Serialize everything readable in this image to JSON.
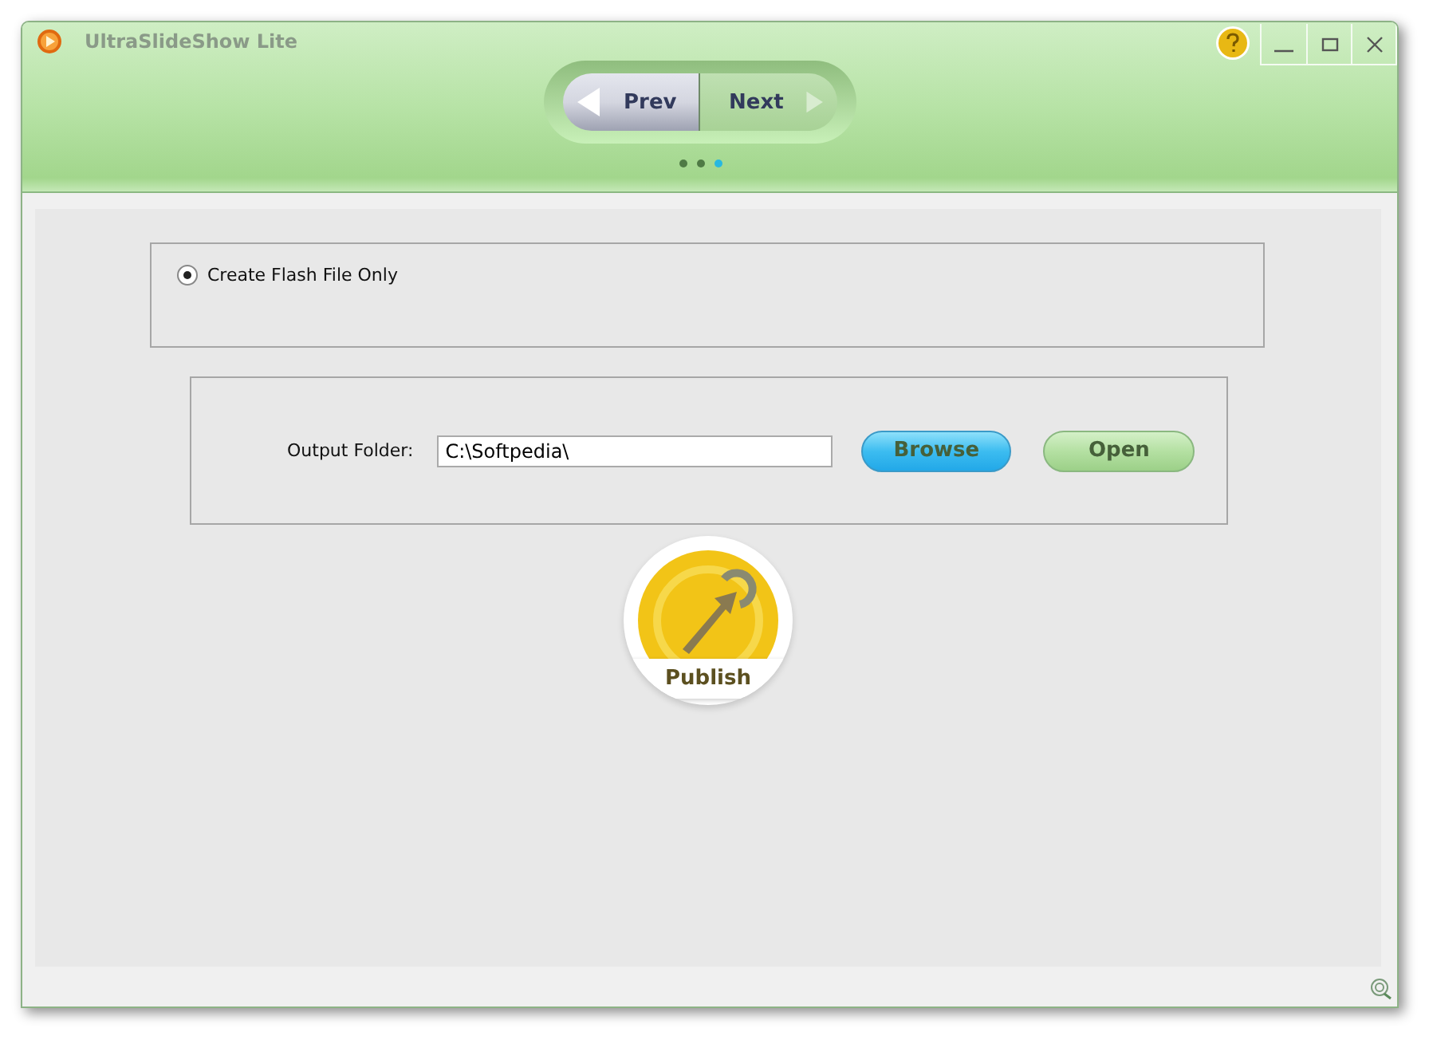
{
  "window": {
    "title": "UltraSlideShow Lite"
  },
  "nav": {
    "prev": "Prev",
    "next": "Next"
  },
  "steps": [
    {
      "selected": false
    },
    {
      "selected": false
    },
    {
      "selected": true
    }
  ],
  "options": [
    {
      "label": "Create Flash File Only",
      "checked": true
    }
  ],
  "output": {
    "label": "Output Folder:",
    "value": "C:\\Softpedia\\",
    "buttons": [
      {
        "label": "Browse",
        "kind": "blue"
      },
      {
        "label": "Open",
        "kind": "green"
      }
    ]
  },
  "publish": {
    "label": "Publish"
  }
}
